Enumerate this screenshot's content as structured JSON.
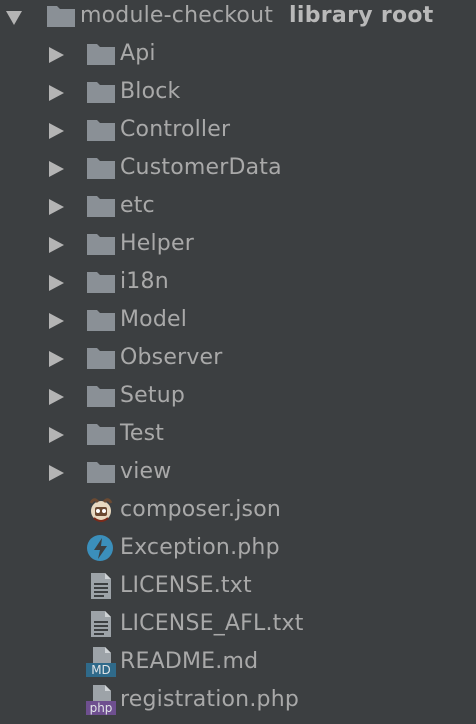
{
  "tree": {
    "root": {
      "name": "module-checkout",
      "tag": "library root",
      "icon": "folder-icon",
      "expanded": true
    },
    "folders": [
      {
        "label": "Api",
        "icon": "folder-icon"
      },
      {
        "label": "Block",
        "icon": "folder-icon"
      },
      {
        "label": "Controller",
        "icon": "folder-icon"
      },
      {
        "label": "CustomerData",
        "icon": "folder-icon"
      },
      {
        "label": "etc",
        "icon": "folder-icon"
      },
      {
        "label": "Helper",
        "icon": "folder-icon"
      },
      {
        "label": "i18n",
        "icon": "folder-icon"
      },
      {
        "label": "Model",
        "icon": "folder-icon"
      },
      {
        "label": "Observer",
        "icon": "folder-icon"
      },
      {
        "label": "Setup",
        "icon": "folder-icon"
      },
      {
        "label": "Test",
        "icon": "folder-icon"
      },
      {
        "label": "view",
        "icon": "folder-icon"
      }
    ],
    "files": [
      {
        "label": "composer.json",
        "icon": "composer-icon"
      },
      {
        "label": "Exception.php",
        "icon": "php-class-icon"
      },
      {
        "label": "LICENSE.txt",
        "icon": "text-file-icon"
      },
      {
        "label": "LICENSE_AFL.txt",
        "icon": "text-file-icon"
      },
      {
        "label": "README.md",
        "icon": "markdown-file-icon",
        "badge": "MD"
      },
      {
        "label": "registration.php",
        "icon": "php-file-icon",
        "badge": "php"
      }
    ]
  },
  "colors": {
    "background": "#3c3f41",
    "text": "#a9a9a9",
    "folder": "#8a9096",
    "arrow": "#b4b4b4",
    "php_class": "#3b8fbb",
    "md_badge": "#2f6a8a",
    "php_badge": "#6e4f8f"
  }
}
